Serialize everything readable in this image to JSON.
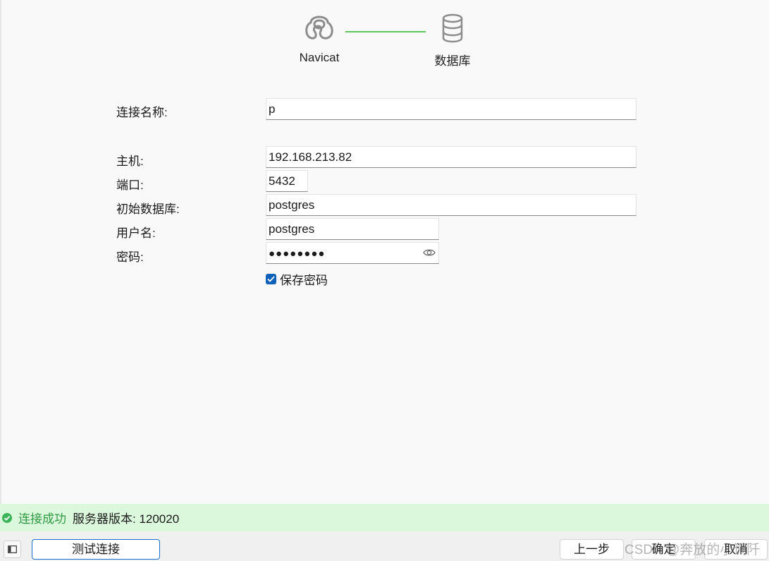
{
  "steps": [
    {
      "label": "Navicat",
      "icon": "navicat-logo-icon"
    },
    {
      "label": "数据库",
      "icon": "database-icon"
    }
  ],
  "colors": {
    "connector": "#5cc75c",
    "status_bg": "#dbf7dc",
    "status_ok": "#2f9a44",
    "checkbox": "#0f62b8",
    "primary_border": "#1a6fc9"
  },
  "form": {
    "connection_name": {
      "label": "连接名称:",
      "value": "p"
    },
    "host": {
      "label": "主机:",
      "value": "192.168.213.82"
    },
    "port": {
      "label": "端口:",
      "value": "5432"
    },
    "initial_db": {
      "label": "初始数据库:",
      "value": "postgres"
    },
    "username": {
      "label": "用户名:",
      "value": "postgres"
    },
    "password": {
      "label": "密码:",
      "value": "●●●●●●●●",
      "reveal_icon": "eye-icon"
    },
    "save_password": {
      "label": "保存密码",
      "checked": true
    }
  },
  "status": {
    "icon": "check-circle-icon",
    "message": "连接成功",
    "server_version": "服务器版本: 120020"
  },
  "buttons": {
    "sidebar_toggle_icon": "sidebar-toggle-icon",
    "test": "测试连接",
    "prev": "上一步",
    "ok": "确定",
    "cancel": "取消"
  },
  "watermark": "CSDN @奔放的小调阡"
}
